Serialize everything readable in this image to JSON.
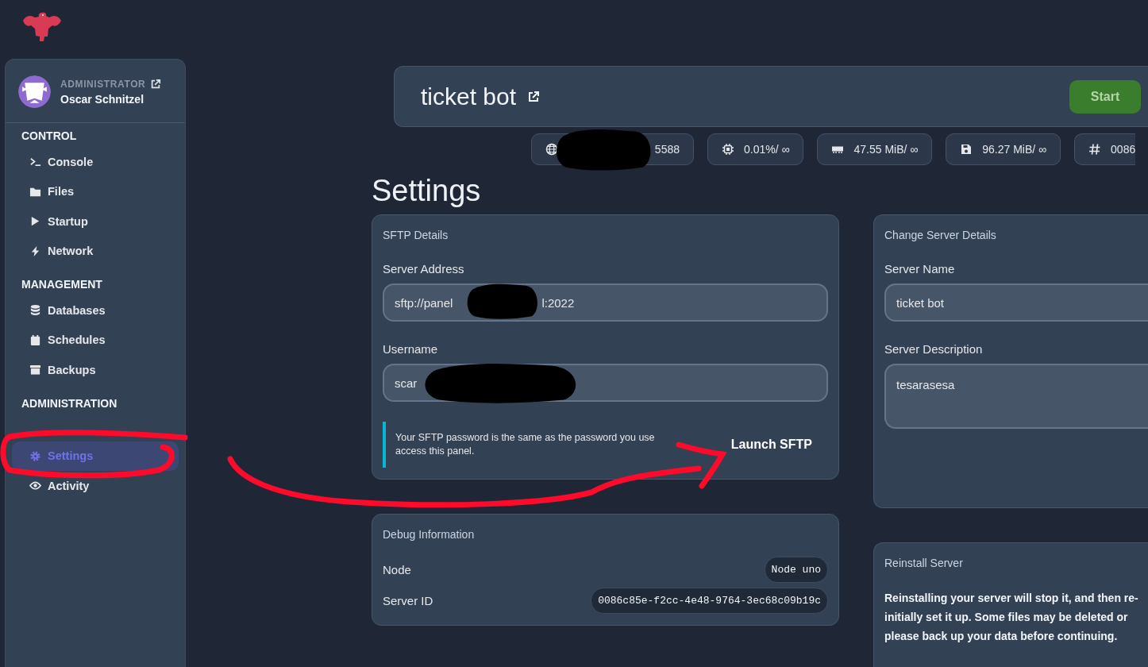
{
  "user": {
    "role": "ADMINISTRATOR",
    "name": "Oscar Schnitzel"
  },
  "nav": [
    {
      "heading": "CONTROL",
      "items": [
        {
          "label": "Console",
          "kind": "terminal",
          "selected": false
        },
        {
          "label": "Files",
          "kind": "folder",
          "selected": false
        },
        {
          "label": "Startup",
          "kind": "play",
          "selected": false
        },
        {
          "label": "Network",
          "kind": "bolt",
          "selected": false
        }
      ]
    },
    {
      "heading": "MANAGEMENT",
      "items": [
        {
          "label": "Databases",
          "kind": "database",
          "selected": false
        },
        {
          "label": "Schedules",
          "kind": "calendar",
          "selected": false
        },
        {
          "label": "Backups",
          "kind": "archive",
          "selected": false
        }
      ]
    },
    {
      "heading": "ADMINISTRATION",
      "items": [
        {
          "label": "Settings",
          "kind": "gear",
          "selected": true
        },
        {
          "label": "Activity",
          "kind": "eye",
          "selected": false
        }
      ]
    }
  ],
  "server": {
    "name": "ticket bot",
    "start": "Start"
  },
  "stats": [
    {
      "kind": "globe",
      "text": "5588",
      "redacted": true
    },
    {
      "kind": "cpu",
      "text": "0.01%/ ∞",
      "redacted": false
    },
    {
      "kind": "memory",
      "text": "47.55 MiB/ ∞",
      "redacted": false
    },
    {
      "kind": "disk",
      "text": "96.27 MiB/ ∞",
      "redacted": false
    },
    {
      "kind": "hash",
      "text": "0086",
      "redacted": false
    }
  ],
  "page_title": "Settings",
  "sftp": {
    "title": "SFTP Details",
    "fields": [
      {
        "label": "Server Address",
        "value": "sftp://panel",
        "value_end": "l:2022",
        "redacted": true
      },
      {
        "label": "Username",
        "value": "scar",
        "redacted": true
      }
    ],
    "note": [
      "Your SFTP password is the same as the password you use",
      "access this panel."
    ],
    "launch": "Launch SFTP"
  },
  "debug": {
    "title": "Debug Information",
    "rows": [
      {
        "label": "Node",
        "value": "Node uno"
      },
      {
        "label": "Server ID",
        "value": "0086c85e-f2cc-4e48-9764-3ec68c09b19c"
      }
    ]
  },
  "change": {
    "title": "Change Server Details",
    "name_label": "Server Name",
    "name_value": "ticket bot",
    "desc_label": "Server Description",
    "desc_value": "tesarasesa"
  },
  "reinstall": {
    "title": "Reinstall Server",
    "lines": [
      "Reinstalling your server will stop it, and then re-",
      "initially set it up. Some files may be deleted or",
      "please back up your data before continuing."
    ]
  }
}
